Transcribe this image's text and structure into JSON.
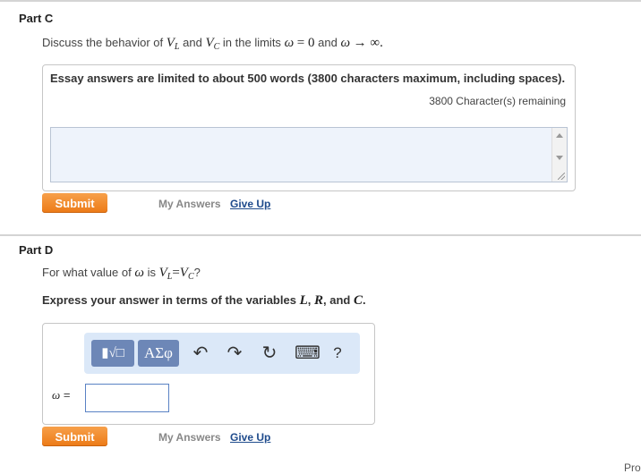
{
  "part_c": {
    "title": "Part C",
    "prompt_prefix": "Discuss the behavior of",
    "var_vl": "V",
    "vl_sub": "L",
    "and1": "and",
    "var_vc": "V",
    "vc_sub": "C",
    "in_limits": "in the limits",
    "omega": "ω",
    "eq0": "= 0",
    "and2": "and",
    "to_inf": "→ ∞.",
    "essay_note": "Essay answers are limited to about 500 words (3800 characters maximum, including spaces).",
    "remaining": "3800 Character(s) remaining",
    "submit": "Submit",
    "my_answers": "My Answers",
    "give_up": "Give Up"
  },
  "part_d": {
    "title": "Part D",
    "q_prefix": "For what value of",
    "omega": "ω",
    "is": "is",
    "v": "V",
    "l_sub": "L",
    "eq": "=",
    "v2": "V",
    "c_sub": "C",
    "qmark": "?",
    "express_prefix": "Express your answer in terms of the variables",
    "var_l": "L",
    "comma1": ",",
    "var_r": "R",
    "comma_and": ", and",
    "var_c": "C",
    "period": ".",
    "omega_label": "ω =",
    "submit": "Submit",
    "my_answers": "My Answers",
    "give_up": "Give Up",
    "toolbar": {
      "template_btn": "▮√□",
      "symbols_btn": "ΑΣφ",
      "undo_icon": "↶",
      "redo_icon": "↷",
      "reset_icon": "↻",
      "keyboard_icon": "⌨",
      "help_icon": "?"
    }
  },
  "corner_text": "Pro"
}
